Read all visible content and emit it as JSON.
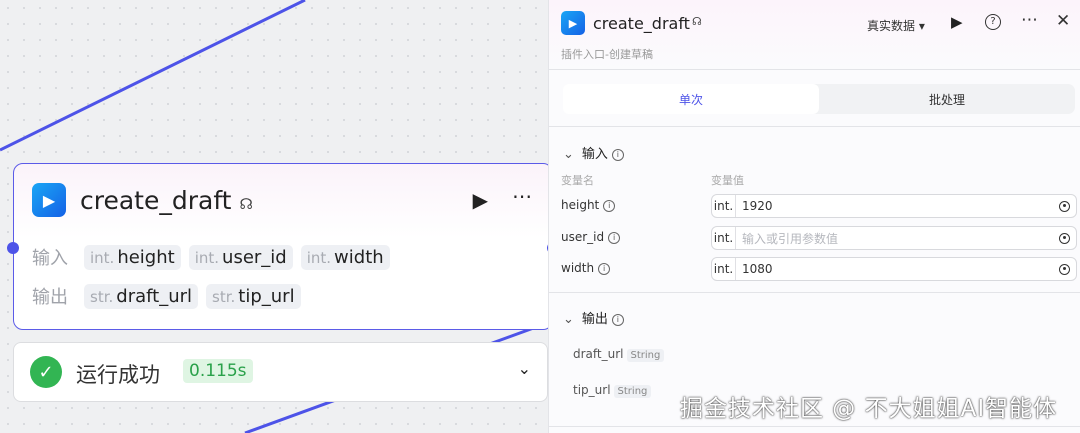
{
  "node": {
    "title": "create_draft",
    "input_label": "输入",
    "output_label": "输出",
    "inputs": [
      {
        "type": "int.",
        "name": "height"
      },
      {
        "type": "int.",
        "name": "user_id"
      },
      {
        "type": "int.",
        "name": "width"
      }
    ],
    "outputs": [
      {
        "type": "str.",
        "name": "draft_url"
      },
      {
        "type": "str.",
        "name": "tip_url"
      }
    ]
  },
  "status": {
    "text": "运行成功",
    "time": "0.115s"
  },
  "panel": {
    "title": "create_draft",
    "subtitle": "插件入口-创建草稿",
    "data_mode": "真实数据",
    "tabs": [
      {
        "label": "单次",
        "active": true
      },
      {
        "label": "批处理",
        "active": false
      }
    ],
    "input_section": "输入",
    "col_name": "变量名",
    "col_value": "变量值",
    "vars": [
      {
        "name": "height",
        "type": "int.",
        "value": "1920",
        "placeholder": ""
      },
      {
        "name": "user_id",
        "type": "int.",
        "value": "",
        "placeholder": "输入或引用参数值"
      },
      {
        "name": "width",
        "type": "int.",
        "value": "1080",
        "placeholder": ""
      }
    ],
    "output_section": "输出",
    "outputs": [
      {
        "name": "draft_url",
        "type": "String"
      },
      {
        "name": "tip_url",
        "type": "String"
      }
    ]
  },
  "watermark": "掘金技术社区 @ 不大姐姐AI智能体",
  "colors": {
    "accent": "#4d53e8",
    "success": "#32b553"
  }
}
